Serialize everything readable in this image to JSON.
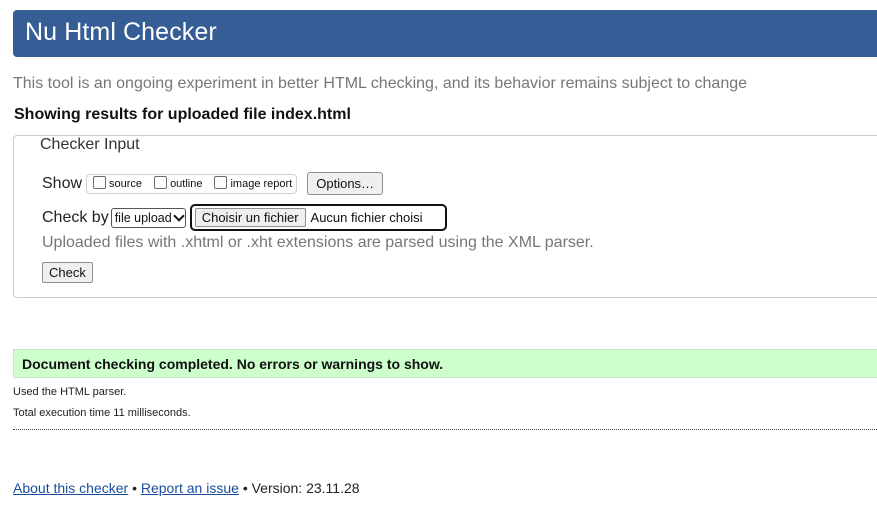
{
  "header": {
    "title": "Nu Html Checker"
  },
  "intro": "This tool is an ongoing experiment in better HTML checking, and its behavior remains subject to change",
  "showing": "Showing results for uploaded file index.html",
  "checker_input": {
    "legend": "Checker Input",
    "show_label": "Show",
    "show_options": [
      {
        "label": "source",
        "checked": false
      },
      {
        "label": "outline",
        "checked": false
      },
      {
        "label": "image report",
        "checked": false
      }
    ],
    "options_button": "Options…",
    "check_by_label": "Check by",
    "check_by_selected": "file upload",
    "file_button": "Choisir un fichier",
    "file_status": "Aucun fichier choisi",
    "xml_note": "Uploaded files with .xhtml or .xht extensions are parsed using the XML parser.",
    "check_button": "Check"
  },
  "results": {
    "success_message": "Document checking completed. No errors or warnings to show.",
    "parser_note": "Used the HTML parser.",
    "execution_time": "Total execution time 11 milliseconds."
  },
  "footer": {
    "about_link": "About this checker",
    "separator": "•",
    "report_link": "Report an issue",
    "version": "Version: 23.11.28"
  },
  "colors": {
    "header_bg": "#365d95",
    "success_bg": "#ccffcc",
    "muted_text": "#777777",
    "link": "#1b4d9e"
  }
}
